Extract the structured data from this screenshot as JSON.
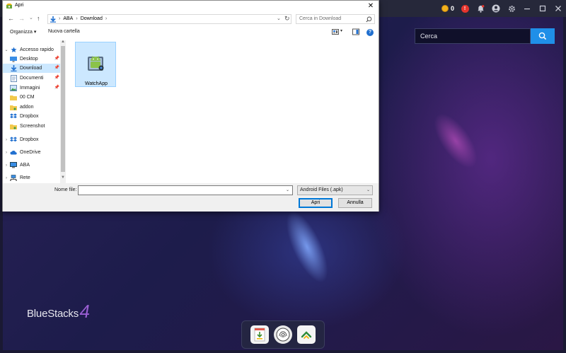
{
  "bluestacks": {
    "coin_count": "0",
    "alert_badge": "!",
    "search_placeholder": "Cerca",
    "logo_text": "BlueStacks",
    "logo_version": "4"
  },
  "dialog": {
    "title": "Apri",
    "close_glyph": "✕",
    "nav": {
      "back": "←",
      "forward": "→",
      "recent": "⌄",
      "up": "↑"
    },
    "breadcrumbs": [
      "ABA",
      "Download"
    ],
    "search_placeholder": "Cerca in Download",
    "toolbar": {
      "organize_label": "Organizza ▾",
      "new_folder_label": "Nuova cartella",
      "help_label": "?"
    },
    "tree": [
      {
        "label": "Accesso rapido",
        "icon": "star-icon",
        "arrow": "⌄"
      },
      {
        "label": "Desktop",
        "icon": "desktop-icon"
      },
      {
        "label": "Download",
        "icon": "download-icon",
        "selected": true
      },
      {
        "label": "Documenti",
        "icon": "documents-icon"
      },
      {
        "label": "Immagini",
        "icon": "pictures-icon"
      },
      {
        "label": "00 CM",
        "icon": "folder-icon"
      },
      {
        "label": "addon",
        "icon": "folder-icon"
      },
      {
        "label": "Dropbox",
        "icon": "dropbox-icon"
      },
      {
        "label": "Screenshot",
        "icon": "folder-icon"
      },
      {
        "label": "Dropbox",
        "icon": "dropbox-icon",
        "arrow": "›"
      },
      {
        "label": "OneDrive",
        "icon": "onedrive-icon",
        "arrow": "›"
      },
      {
        "label": "ABA",
        "icon": "computer-icon",
        "arrow": "›"
      },
      {
        "label": "Rete",
        "icon": "network-icon",
        "arrow": "›"
      }
    ],
    "files": [
      {
        "name": "WatchApp",
        "icon": "android-apk-icon"
      }
    ],
    "filename_label": "Nome file:",
    "filename_value": "",
    "filetype": "Android Files (.apk)",
    "open_button": "Apri",
    "cancel_button": "Annulla"
  },
  "colors": {
    "accent_blue": "#1f8fe8",
    "selection": "#cce8ff",
    "alert_red": "#e5352d",
    "coin_gold": "#f2b11d",
    "logo_purple": "#9b5fd4"
  }
}
